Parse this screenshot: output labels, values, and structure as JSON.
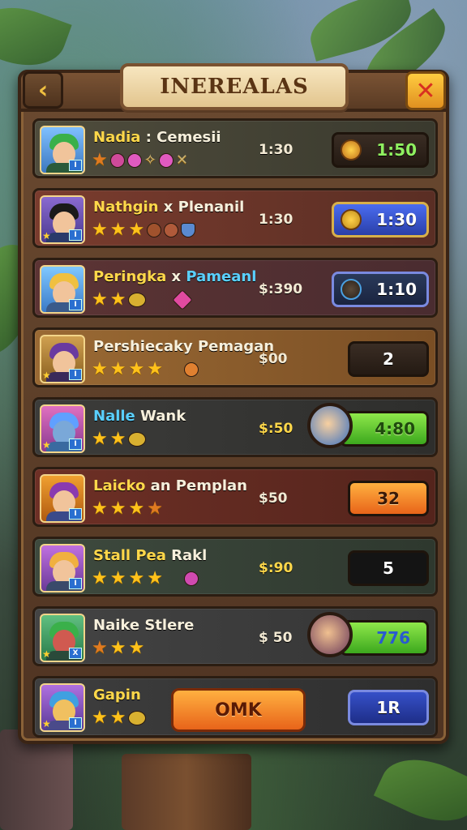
{
  "header": {
    "title": "INEREALAS",
    "back_icon": "chevron-left-icon",
    "close_icon": "close-icon"
  },
  "rows": [
    {
      "name": "Nadia : Cemesii",
      "name_hl": "Nadia",
      "price": "1:30",
      "button": "1:50",
      "button_style": "dark-green",
      "stars": 1,
      "row_color": "#4b4a3a"
    },
    {
      "name": "Nathgin x Plenanil",
      "name_hl": "Nathgin",
      "price": "1:30",
      "button": "1:30",
      "button_style": "blue",
      "stars": 3,
      "row_color": "#6a3a2e"
    },
    {
      "name": "Peringka x Pameanl",
      "name_hl": "Peringka",
      "price": "$:390",
      "button": "1:10",
      "button_style": "navy",
      "stars": 2,
      "row_color": "#5a3436"
    },
    {
      "name": "Pershiecaky Pemagan",
      "name_hl": "",
      "price": "$00",
      "button": "2",
      "button_style": "dark",
      "stars": 4,
      "row_color": "#8a5a2a"
    },
    {
      "name": "Nalle Wank",
      "name_hl": "Nalle",
      "price": "$:50",
      "button": "4:80",
      "button_style": "green",
      "stars": 2,
      "row_color": "#3a3a38"
    },
    {
      "name": "Laicko an Pemplan",
      "name_hl": "Laicko",
      "price": "$50",
      "button": "32",
      "button_style": "orange",
      "stars": 4,
      "row_color": "#6a2e24"
    },
    {
      "name": "Stall Pea Rakl",
      "name_hl": "Stall Pea",
      "price": "$:90",
      "button": "5",
      "button_style": "dark",
      "stars": 4,
      "row_color": "#3a443a"
    },
    {
      "name": "Naike Stlere",
      "name_hl": "",
      "price": "$ 50",
      "button": "776",
      "button_style": "green",
      "stars": 3,
      "row_color": "#404040"
    },
    {
      "name": "Gapin",
      "name_hl": "Gapin",
      "price": "",
      "button": "1R",
      "button_style": "navy",
      "stars": 2,
      "row_color": "#3a3a3a",
      "cta": "OMK"
    }
  ]
}
